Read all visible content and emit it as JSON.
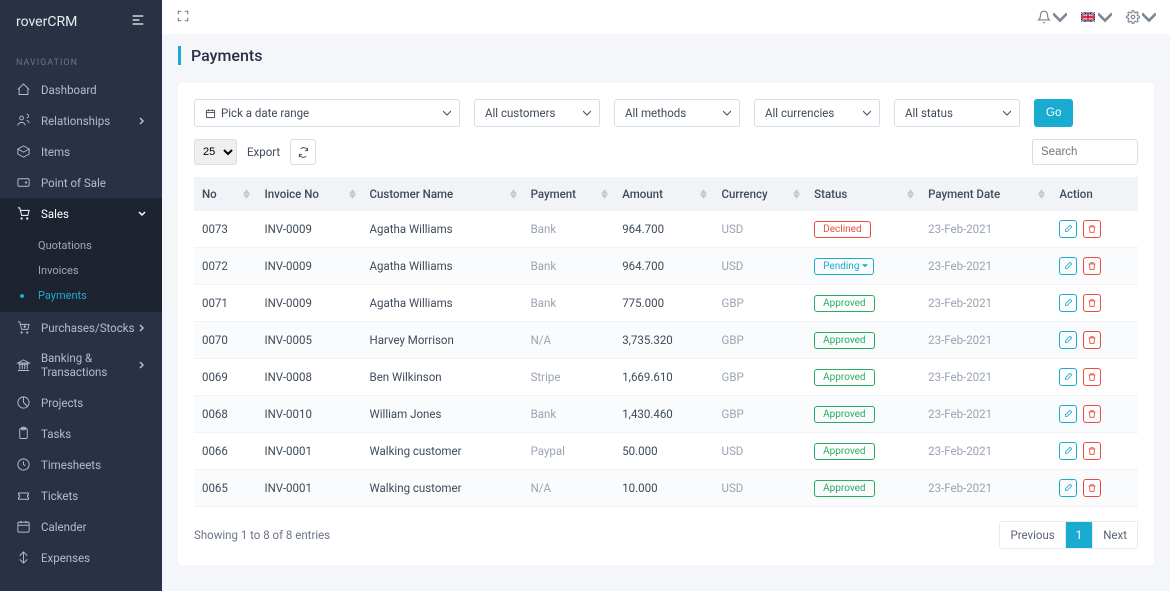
{
  "brand": "roverCRM",
  "nav_title": "NAVIGATION",
  "sidebar": {
    "items": [
      {
        "label": "Dashboard",
        "icon": "home"
      },
      {
        "label": "Relationships",
        "icon": "users",
        "expandable": true
      },
      {
        "label": "Items",
        "icon": "box"
      },
      {
        "label": "Point of Sale",
        "icon": "wallet"
      },
      {
        "label": "Sales",
        "icon": "cart",
        "expandable": true,
        "active": true,
        "sub": [
          {
            "label": "Quotations"
          },
          {
            "label": "Invoices"
          },
          {
            "label": "Payments",
            "active": true
          }
        ]
      },
      {
        "label": "Purchases/Stocks",
        "icon": "cartdown",
        "expandable": true
      },
      {
        "label": "Banking & Transactions",
        "icon": "bank",
        "expandable": true
      },
      {
        "label": "Projects",
        "icon": "pie"
      },
      {
        "label": "Tasks",
        "icon": "clipboard"
      },
      {
        "label": "Timesheets",
        "icon": "clock"
      },
      {
        "label": "Tickets",
        "icon": "ticket"
      },
      {
        "label": "Calender",
        "icon": "calendar"
      },
      {
        "label": "Expenses",
        "icon": "expense"
      }
    ]
  },
  "page": {
    "title": "Payments"
  },
  "filters": {
    "date_placeholder": "Pick a date range",
    "customers": "All customers",
    "methods": "All methods",
    "currencies": "All currencies",
    "status": "All status",
    "go": "Go"
  },
  "toolbar": {
    "page_size": "25",
    "export": "Export",
    "search_placeholder": "Search"
  },
  "table": {
    "headers": [
      "No",
      "Invoice No",
      "Customer Name",
      "Payment",
      "Amount",
      "Currency",
      "Status",
      "Payment Date",
      "Action"
    ],
    "rows": [
      {
        "no": "0073",
        "inv": "INV-0009",
        "cust": "Agatha Williams",
        "pay": "Bank",
        "amt": "964.700",
        "cur": "USD",
        "status": "Declined",
        "status_class": "declined",
        "date": "23-Feb-2021"
      },
      {
        "no": "0072",
        "inv": "INV-0009",
        "cust": "Agatha Williams",
        "pay": "Bank",
        "amt": "964.700",
        "cur": "USD",
        "status": "Pending",
        "status_class": "pending",
        "date": "23-Feb-2021"
      },
      {
        "no": "0071",
        "inv": "INV-0009",
        "cust": "Agatha Williams",
        "pay": "Bank",
        "amt": "775.000",
        "cur": "GBP",
        "status": "Approved",
        "status_class": "approved",
        "date": "23-Feb-2021"
      },
      {
        "no": "0070",
        "inv": "INV-0005",
        "cust": "Harvey Morrison",
        "pay": "N/A",
        "amt": "3,735.320",
        "cur": "GBP",
        "status": "Approved",
        "status_class": "approved",
        "date": "23-Feb-2021"
      },
      {
        "no": "0069",
        "inv": "INV-0008",
        "cust": "Ben Wilkinson",
        "pay": "Stripe",
        "amt": "1,669.610",
        "cur": "GBP",
        "status": "Approved",
        "status_class": "approved",
        "date": "23-Feb-2021"
      },
      {
        "no": "0068",
        "inv": "INV-0010",
        "cust": "William Jones",
        "pay": "Bank",
        "amt": "1,430.460",
        "cur": "GBP",
        "status": "Approved",
        "status_class": "approved",
        "date": "23-Feb-2021"
      },
      {
        "no": "0066",
        "inv": "INV-0001",
        "cust": "Walking customer",
        "pay": "Paypal",
        "amt": "50.000",
        "cur": "USD",
        "status": "Approved",
        "status_class": "approved",
        "date": "23-Feb-2021"
      },
      {
        "no": "0065",
        "inv": "INV-0001",
        "cust": "Walking customer",
        "pay": "N/A",
        "amt": "10.000",
        "cur": "USD",
        "status": "Approved",
        "status_class": "approved",
        "date": "23-Feb-2021"
      }
    ]
  },
  "footer": {
    "info": "Showing 1 to 8 of 8 entries",
    "prev": "Previous",
    "page": "1",
    "next": "Next"
  }
}
